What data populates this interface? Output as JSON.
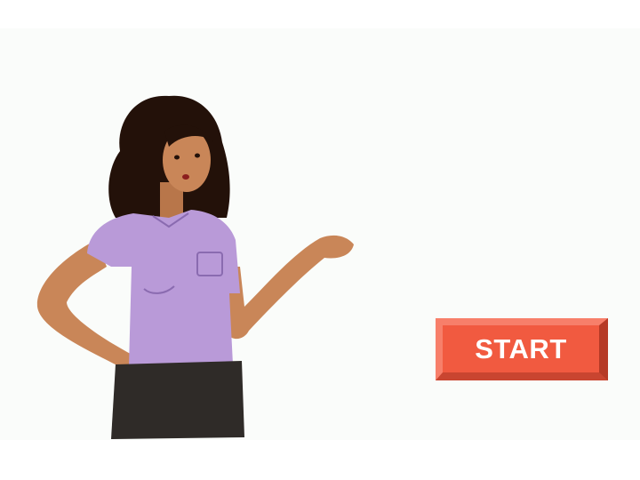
{
  "start_button": {
    "label": "START",
    "color": "#f15a40"
  },
  "colors": {
    "background": "#fafcfa",
    "shirt": "#b99ad8",
    "skin": "#c98658",
    "hair": "#231109",
    "shorts": "#2f2b28"
  }
}
